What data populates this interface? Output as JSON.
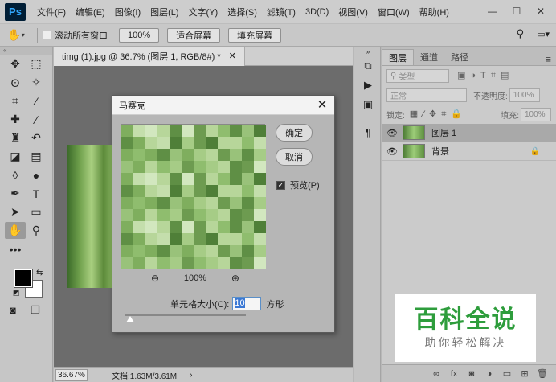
{
  "app": {
    "logo": "Ps"
  },
  "menu": [
    "文件(F)",
    "编辑(E)",
    "图像(I)",
    "图层(L)",
    "文字(Y)",
    "选择(S)",
    "滤镜(T)",
    "3D(D)",
    "视图(V)",
    "窗口(W)",
    "帮助(H)"
  ],
  "window_controls": [
    "—",
    "☐",
    "✕"
  ],
  "options": {
    "scroll_all": "滚动所有窗口",
    "zoom_value": "100%",
    "fit_screen": "适合屏幕",
    "fill_screen": "填充屏幕"
  },
  "document": {
    "tab_title": "timg (1).jpg @ 36.7% (图层 1, RGB/8#) *",
    "zoom": "36.67%",
    "doc_info": "文档:1.63M/3.61M"
  },
  "layers_panel": {
    "tabs": [
      "图层",
      "通道",
      "路径"
    ],
    "filter": "类型",
    "blend_mode": "正常",
    "opacity_label": "不透明度:",
    "opacity_value": "100%",
    "lock_label": "锁定:",
    "fill_label": "填充:",
    "fill_value": "100%",
    "layers": [
      {
        "name": "图层 1",
        "selected": true
      },
      {
        "name": "背景",
        "locked": true
      }
    ]
  },
  "dialog": {
    "title": "马赛克",
    "ok": "确定",
    "cancel": "取消",
    "preview_label": "预览(P)",
    "preview_checked": true,
    "zoom": "100%",
    "cell_size_label": "单元格大小(C):",
    "cell_size_value": "10",
    "unit": "方形"
  },
  "watermark": {
    "main": "百科全说",
    "sub": "助你轻松解决"
  },
  "colors": {
    "foreground": "#000000",
    "background": "#ffffff",
    "watermark_green": "#2e9d3c"
  }
}
